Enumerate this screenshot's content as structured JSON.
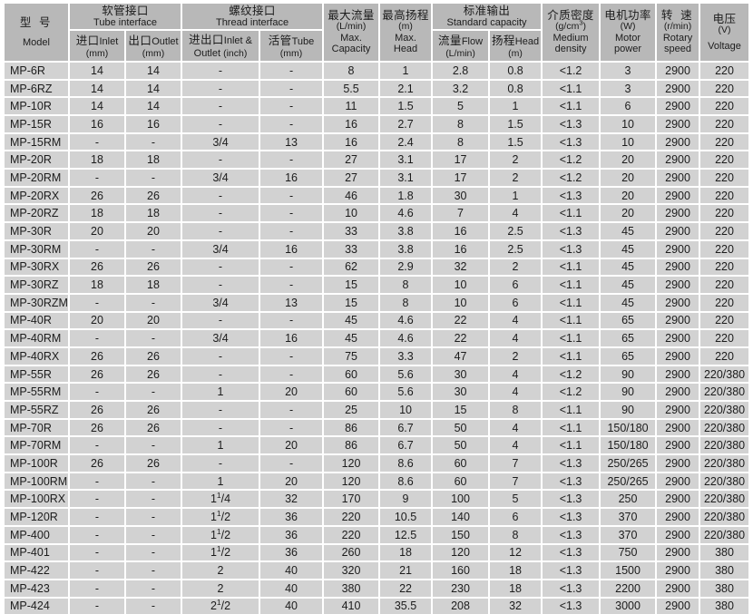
{
  "table": {
    "header": {
      "groups": [
        {
          "id": "model",
          "cn": "型 号",
          "en": "Model",
          "spaced": true,
          "colspan": 1
        },
        {
          "id": "tube_interface",
          "cn": "软管接口",
          "en": "Tube interface",
          "colspan": 2
        },
        {
          "id": "thread_interface",
          "cn": "螺纹接口",
          "en": "Thread interface",
          "colspan": 2
        },
        {
          "id": "max_capacity",
          "cn": "最大流量",
          "unit": "(L/min)",
          "en_line1": "Max.",
          "en_line2": "Capacity",
          "colspan": 1
        },
        {
          "id": "max_head",
          "cn": "最高扬程",
          "unit": "(m)",
          "en_line1": "Max.",
          "en_line2": "Head",
          "colspan": 1
        },
        {
          "id": "standard_capacity",
          "cn": "标准输出",
          "en": "Standard capacity",
          "colspan": 2
        },
        {
          "id": "medium_density",
          "cn": "介质密度",
          "unit": "(g/cm3)",
          "unit_base": "(g/cm",
          "unit_sup": "3",
          "unit_tail": ")",
          "en_line1": "Medium",
          "en_line2": "density",
          "colspan": 1
        },
        {
          "id": "motor_power",
          "cn": "电机功率",
          "unit": "(W)",
          "en_line1": "Motor",
          "en_line2": "power",
          "colspan": 1
        },
        {
          "id": "rotary_speed",
          "cn": "转 速",
          "spaced": true,
          "unit": "(r/min)",
          "en_line1": "Rotary",
          "en_line2": "speed",
          "colspan": 1
        },
        {
          "id": "voltage",
          "cn": "电压",
          "unit": "(V)",
          "en": "Voltage",
          "colspan": 1
        }
      ],
      "sub": [
        {
          "id": "inlet_mm",
          "cn": "进口",
          "en": "Inlet",
          "unit": "(mm)"
        },
        {
          "id": "outlet_mm",
          "cn": "出口",
          "en": "Outlet",
          "unit": "(mm)"
        },
        {
          "id": "inlet_outlet_in",
          "cn": "进出口",
          "en": "Inlet &",
          "en2": "Outlet",
          "unit": "(inch)"
        },
        {
          "id": "tube_mm",
          "cn": "活管",
          "en": "Tube",
          "unit": "(mm)"
        },
        {
          "id": "flow_lmin",
          "cn": "流量",
          "en": "Flow",
          "unit": "(L/min)"
        },
        {
          "id": "head_m",
          "cn": "扬程",
          "en": "Head",
          "unit": "(m)"
        }
      ]
    },
    "columns": [
      "model",
      "inlet_mm",
      "outlet_mm",
      "inlet_outlet_in",
      "tube_mm",
      "max_capacity",
      "max_head",
      "flow_lmin",
      "head_m",
      "medium_density",
      "motor_power",
      "rotary_speed",
      "voltage"
    ],
    "rows": [
      {
        "model": "MP-6R",
        "inlet_mm": "14",
        "outlet_mm": "14",
        "inlet_outlet_in": "-",
        "tube_mm": "-",
        "max_capacity": "8",
        "max_head": "1",
        "flow_lmin": "2.8",
        "head_m": "0.8",
        "medium_density": "<1.2",
        "motor_power": "3",
        "rotary_speed": "2900",
        "voltage": "220"
      },
      {
        "model": "MP-6RZ",
        "inlet_mm": "14",
        "outlet_mm": "14",
        "inlet_outlet_in": "-",
        "tube_mm": "-",
        "max_capacity": "5.5",
        "max_head": "2.1",
        "flow_lmin": "3.2",
        "head_m": "0.8",
        "medium_density": "<1.1",
        "motor_power": "3",
        "rotary_speed": "2900",
        "voltage": "220"
      },
      {
        "model": "MP-10R",
        "inlet_mm": "14",
        "outlet_mm": "14",
        "inlet_outlet_in": "-",
        "tube_mm": "-",
        "max_capacity": "11",
        "max_head": "1.5",
        "flow_lmin": "5",
        "head_m": "1",
        "medium_density": "<1.1",
        "motor_power": "6",
        "rotary_speed": "2900",
        "voltage": "220"
      },
      {
        "model": "MP-15R",
        "inlet_mm": "16",
        "outlet_mm": "16",
        "inlet_outlet_in": "-",
        "tube_mm": "-",
        "max_capacity": "16",
        "max_head": "2.7",
        "flow_lmin": "8",
        "head_m": "1.5",
        "medium_density": "<1.3",
        "motor_power": "10",
        "rotary_speed": "2900",
        "voltage": "220"
      },
      {
        "model": "MP-15RM",
        "inlet_mm": "-",
        "outlet_mm": "-",
        "inlet_outlet_in": "3/4",
        "tube_mm": "13",
        "max_capacity": "16",
        "max_head": "2.4",
        "flow_lmin": "8",
        "head_m": "1.5",
        "medium_density": "<1.3",
        "motor_power": "10",
        "rotary_speed": "2900",
        "voltage": "220"
      },
      {
        "model": "MP-20R",
        "inlet_mm": "18",
        "outlet_mm": "18",
        "inlet_outlet_in": "-",
        "tube_mm": "-",
        "max_capacity": "27",
        "max_head": "3.1",
        "flow_lmin": "17",
        "head_m": "2",
        "medium_density": "<1.2",
        "motor_power": "20",
        "rotary_speed": "2900",
        "voltage": "220"
      },
      {
        "model": "MP-20RM",
        "inlet_mm": "-",
        "outlet_mm": "-",
        "inlet_outlet_in": "3/4",
        "tube_mm": "16",
        "max_capacity": "27",
        "max_head": "3.1",
        "flow_lmin": "17",
        "head_m": "2",
        "medium_density": "<1.2",
        "motor_power": "20",
        "rotary_speed": "2900",
        "voltage": "220"
      },
      {
        "model": "MP-20RX",
        "inlet_mm": "26",
        "outlet_mm": "26",
        "inlet_outlet_in": "-",
        "tube_mm": "-",
        "max_capacity": "46",
        "max_head": "1.8",
        "flow_lmin": "30",
        "head_m": "1",
        "medium_density": "<1.3",
        "motor_power": "20",
        "rotary_speed": "2900",
        "voltage": "220"
      },
      {
        "model": "MP-20RZ",
        "inlet_mm": "18",
        "outlet_mm": "18",
        "inlet_outlet_in": "-",
        "tube_mm": "-",
        "max_capacity": "10",
        "max_head": "4.6",
        "flow_lmin": "7",
        "head_m": "4",
        "medium_density": "<1.1",
        "motor_power": "20",
        "rotary_speed": "2900",
        "voltage": "220"
      },
      {
        "model": "MP-30R",
        "inlet_mm": "20",
        "outlet_mm": "20",
        "inlet_outlet_in": "-",
        "tube_mm": "-",
        "max_capacity": "33",
        "max_head": "3.8",
        "flow_lmin": "16",
        "head_m": "2.5",
        "medium_density": "<1.3",
        "motor_power": "45",
        "rotary_speed": "2900",
        "voltage": "220"
      },
      {
        "model": "MP-30RM",
        "inlet_mm": "-",
        "outlet_mm": "-",
        "inlet_outlet_in": "3/4",
        "tube_mm": "16",
        "max_capacity": "33",
        "max_head": "3.8",
        "flow_lmin": "16",
        "head_m": "2.5",
        "medium_density": "<1.3",
        "motor_power": "45",
        "rotary_speed": "2900",
        "voltage": "220"
      },
      {
        "model": "MP-30RX",
        "inlet_mm": "26",
        "outlet_mm": "26",
        "inlet_outlet_in": "-",
        "tube_mm": "-",
        "max_capacity": "62",
        "max_head": "2.9",
        "flow_lmin": "32",
        "head_m": "2",
        "medium_density": "<1.1",
        "motor_power": "45",
        "rotary_speed": "2900",
        "voltage": "220"
      },
      {
        "model": "MP-30RZ",
        "inlet_mm": "18",
        "outlet_mm": "18",
        "inlet_outlet_in": "-",
        "tube_mm": "-",
        "max_capacity": "15",
        "max_head": "8",
        "flow_lmin": "10",
        "head_m": "6",
        "medium_density": "<1.1",
        "motor_power": "45",
        "rotary_speed": "2900",
        "voltage": "220"
      },
      {
        "model": "MP-30RZM",
        "inlet_mm": "-",
        "outlet_mm": "-",
        "inlet_outlet_in": "3/4",
        "tube_mm": "13",
        "max_capacity": "15",
        "max_head": "8",
        "flow_lmin": "10",
        "head_m": "6",
        "medium_density": "<1.1",
        "motor_power": "45",
        "rotary_speed": "2900",
        "voltage": "220"
      },
      {
        "model": "MP-40R",
        "inlet_mm": "20",
        "outlet_mm": "20",
        "inlet_outlet_in": "-",
        "tube_mm": "-",
        "max_capacity": "45",
        "max_head": "4.6",
        "flow_lmin": "22",
        "head_m": "4",
        "medium_density": "<1.1",
        "motor_power": "65",
        "rotary_speed": "2900",
        "voltage": "220"
      },
      {
        "model": "MP-40RM",
        "inlet_mm": "-",
        "outlet_mm": "-",
        "inlet_outlet_in": "3/4",
        "tube_mm": "16",
        "max_capacity": "45",
        "max_head": "4.6",
        "flow_lmin": "22",
        "head_m": "4",
        "medium_density": "<1.1",
        "motor_power": "65",
        "rotary_speed": "2900",
        "voltage": "220"
      },
      {
        "model": "MP-40RX",
        "inlet_mm": "26",
        "outlet_mm": "26",
        "inlet_outlet_in": "-",
        "tube_mm": "-",
        "max_capacity": "75",
        "max_head": "3.3",
        "flow_lmin": "47",
        "head_m": "2",
        "medium_density": "<1.1",
        "motor_power": "65",
        "rotary_speed": "2900",
        "voltage": "220"
      },
      {
        "model": "MP-55R",
        "inlet_mm": "26",
        "outlet_mm": "26",
        "inlet_outlet_in": "-",
        "tube_mm": "-",
        "max_capacity": "60",
        "max_head": "5.6",
        "flow_lmin": "30",
        "head_m": "4",
        "medium_density": "<1.2",
        "motor_power": "90",
        "rotary_speed": "2900",
        "voltage": "220/380"
      },
      {
        "model": "MP-55RM",
        "inlet_mm": "-",
        "outlet_mm": "-",
        "inlet_outlet_in": "1",
        "tube_mm": "20",
        "max_capacity": "60",
        "max_head": "5.6",
        "flow_lmin": "30",
        "head_m": "4",
        "medium_density": "<1.2",
        "motor_power": "90",
        "rotary_speed": "2900",
        "voltage": "220/380"
      },
      {
        "model": "MP-55RZ",
        "inlet_mm": "26",
        "outlet_mm": "26",
        "inlet_outlet_in": "-",
        "tube_mm": "-",
        "max_capacity": "25",
        "max_head": "10",
        "flow_lmin": "15",
        "head_m": "8",
        "medium_density": "<1.1",
        "motor_power": "90",
        "rotary_speed": "2900",
        "voltage": "220/380"
      },
      {
        "model": "MP-70R",
        "inlet_mm": "26",
        "outlet_mm": "26",
        "inlet_outlet_in": "-",
        "tube_mm": "-",
        "max_capacity": "86",
        "max_head": "6.7",
        "flow_lmin": "50",
        "head_m": "4",
        "medium_density": "<1.1",
        "motor_power": "150/180",
        "rotary_speed": "2900",
        "voltage": "220/380"
      },
      {
        "model": "MP-70RM",
        "inlet_mm": "-",
        "outlet_mm": "-",
        "inlet_outlet_in": "1",
        "tube_mm": "20",
        "max_capacity": "86",
        "max_head": "6.7",
        "flow_lmin": "50",
        "head_m": "4",
        "medium_density": "<1.1",
        "motor_power": "150/180",
        "rotary_speed": "2900",
        "voltage": "220/380"
      },
      {
        "model": "MP-100R",
        "inlet_mm": "26",
        "outlet_mm": "26",
        "inlet_outlet_in": "-",
        "tube_mm": "-",
        "max_capacity": "120",
        "max_head": "8.6",
        "flow_lmin": "60",
        "head_m": "7",
        "medium_density": "<1.3",
        "motor_power": "250/265",
        "rotary_speed": "2900",
        "voltage": "220/380"
      },
      {
        "model": "MP-100RM",
        "inlet_mm": "-",
        "outlet_mm": "-",
        "inlet_outlet_in": "1",
        "tube_mm": "20",
        "max_capacity": "120",
        "max_head": "8.6",
        "flow_lmin": "60",
        "head_m": "7",
        "medium_density": "<1.3",
        "motor_power": "250/265",
        "rotary_speed": "2900",
        "voltage": "220/380"
      },
      {
        "model": "MP-100RX",
        "inlet_mm": "-",
        "outlet_mm": "-",
        "inlet_outlet_in": "1 1/4",
        "tube_mm": "32",
        "max_capacity": "170",
        "max_head": "9",
        "flow_lmin": "100",
        "head_m": "5",
        "medium_density": "<1.3",
        "motor_power": "250",
        "rotary_speed": "2900",
        "voltage": "220/380"
      },
      {
        "model": "MP-120R",
        "inlet_mm": "-",
        "outlet_mm": "-",
        "inlet_outlet_in": "1 1/2",
        "tube_mm": "36",
        "max_capacity": "220",
        "max_head": "10.5",
        "flow_lmin": "140",
        "head_m": "6",
        "medium_density": "<1.3",
        "motor_power": "370",
        "rotary_speed": "2900",
        "voltage": "220/380"
      },
      {
        "model": "MP-400",
        "inlet_mm": "-",
        "outlet_mm": "-",
        "inlet_outlet_in": "1 1/2",
        "tube_mm": "36",
        "max_capacity": "220",
        "max_head": "12.5",
        "flow_lmin": "150",
        "head_m": "8",
        "medium_density": "<1.3",
        "motor_power": "370",
        "rotary_speed": "2900",
        "voltage": "220/380"
      },
      {
        "model": "MP-401",
        "inlet_mm": "-",
        "outlet_mm": "-",
        "inlet_outlet_in": "1 1/2",
        "tube_mm": "36",
        "max_capacity": "260",
        "max_head": "18",
        "flow_lmin": "120",
        "head_m": "12",
        "medium_density": "<1.3",
        "motor_power": "750",
        "rotary_speed": "2900",
        "voltage": "380"
      },
      {
        "model": "MP-422",
        "inlet_mm": "-",
        "outlet_mm": "-",
        "inlet_outlet_in": "2",
        "tube_mm": "40",
        "max_capacity": "320",
        "max_head": "21",
        "flow_lmin": "160",
        "head_m": "18",
        "medium_density": "<1.3",
        "motor_power": "1500",
        "rotary_speed": "2900",
        "voltage": "380"
      },
      {
        "model": "MP-423",
        "inlet_mm": "-",
        "outlet_mm": "-",
        "inlet_outlet_in": "2",
        "tube_mm": "40",
        "max_capacity": "380",
        "max_head": "22",
        "flow_lmin": "230",
        "head_m": "18",
        "medium_density": "<1.3",
        "motor_power": "2200",
        "rotary_speed": "2900",
        "voltage": "380"
      },
      {
        "model": "MP-424",
        "inlet_mm": "-",
        "outlet_mm": "-",
        "inlet_outlet_in": "2 1/2",
        "tube_mm": "40",
        "max_capacity": "410",
        "max_head": "35.5",
        "flow_lmin": "208",
        "head_m": "32",
        "medium_density": "<1.3",
        "motor_power": "3000",
        "rotary_speed": "2900",
        "voltage": "380"
      }
    ]
  },
  "colors": {
    "header_bg": "#b8b8b8",
    "cell_bg": "#d2d2d2",
    "grid": "#ffffff",
    "text": "#1c1c1c"
  }
}
